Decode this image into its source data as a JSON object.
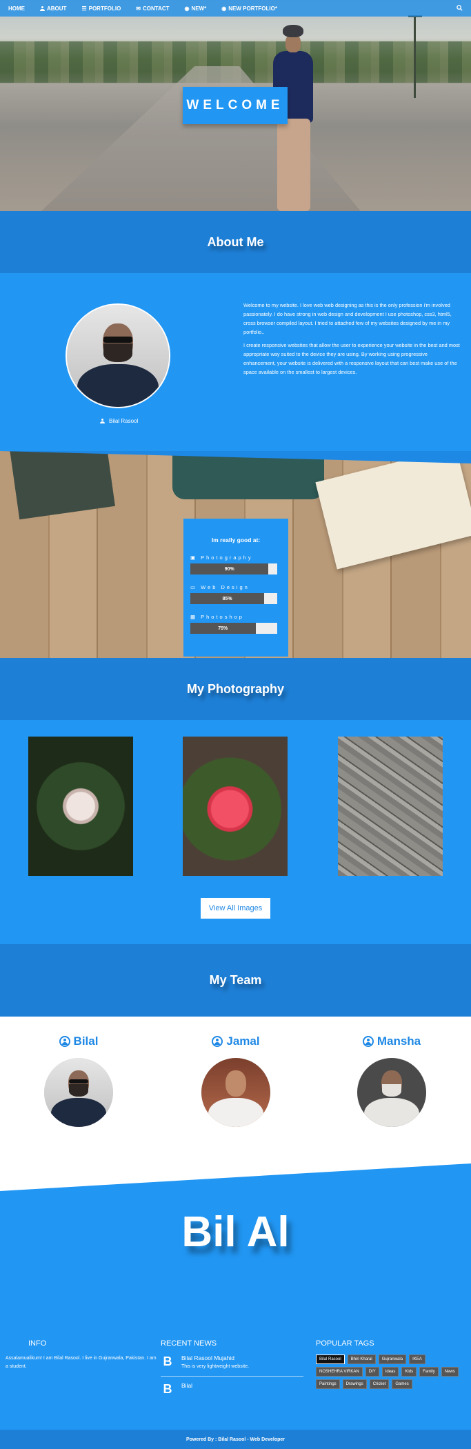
{
  "nav": {
    "items": [
      {
        "label": "HOME",
        "icon": ""
      },
      {
        "label": "ABOUT",
        "icon": "person-icon"
      },
      {
        "label": "PORTFOLIO",
        "icon": "list-icon"
      },
      {
        "label": "CONTACT",
        "icon": "envelope-icon"
      },
      {
        "label": "NEW*",
        "icon": "globe-icon"
      },
      {
        "label": "NEW PORTFOLIO*",
        "icon": "globe-icon"
      }
    ],
    "search_icon": "search-icon"
  },
  "hero": {
    "welcome": "WELCOME"
  },
  "about": {
    "heading": "About Me",
    "caption": "Bilal Rasool",
    "paragraphs": [
      "Welcome to my website. I love web web designing as this is the only profession i'm involved passionately. I do have strong in web design and development I use photoshop, css3, html5, cross browser compiled layout. I tried to attached few of my websites designed by me in my portfolio..",
      "I create responsive websites that allow the user to experience your website in the best and most appropriate way suited to the device they are using. By working using progressive enhancement, your website is delivered with a responsive layout that can best make use of the space available on the smallest to largest devices."
    ]
  },
  "skills": {
    "heading": "Im really good at:",
    "items": [
      {
        "label": "Photography",
        "percent": 90,
        "text": "90%",
        "icon": "camera-icon"
      },
      {
        "label": "Web Design",
        "percent": 85,
        "text": "85%",
        "icon": "laptop-icon"
      },
      {
        "label": "Photoshop",
        "percent": 75,
        "text": "75%",
        "icon": "image-icon"
      }
    ]
  },
  "photography": {
    "heading": "My Photography",
    "button": "View All Images"
  },
  "team": {
    "heading": "My Team",
    "members": [
      {
        "name": "Bilal"
      },
      {
        "name": "Jamal"
      },
      {
        "name": "Mansha"
      }
    ]
  },
  "brand": {
    "text": "Bil Al"
  },
  "footer": {
    "info": {
      "heading": "INFO",
      "text": "Assalamualikum! I am Bilal Rasool. I live in Gujranwala, Pakistan. I am a student."
    },
    "news": {
      "heading": "RECENT NEWS",
      "items": [
        {
          "letter": "B",
          "title": "Bilal Rasool Mujahid",
          "text": "This is very lightweight website."
        },
        {
          "letter": "B",
          "title": "Bilal",
          "text": ""
        }
      ]
    },
    "tags": {
      "heading": "POPULAR TAGS",
      "items": [
        "Bilal Rasool",
        "Bhiri Kharal",
        "Gujranwala",
        "IKEA",
        "NOSHEHRA VIRKAN",
        "DIY",
        "Ideas",
        "Kids",
        "Family",
        "News",
        "Paintings",
        "Drawings",
        "Cricket",
        "Games"
      ]
    },
    "powered": "Powered By : Bilal Rasool - Web Developer"
  },
  "colors": {
    "primary": "#2196f3",
    "dark": "#1e7fd6",
    "bar": "#555555"
  }
}
